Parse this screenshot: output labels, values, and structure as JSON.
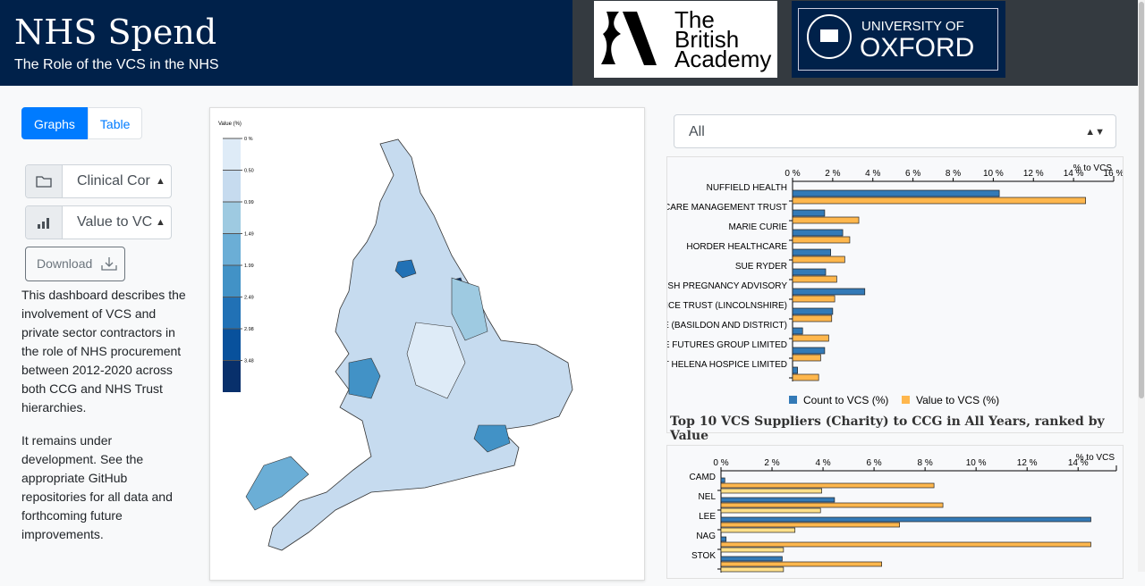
{
  "header": {
    "title": "NHS Spend",
    "subtitle": "The Role of the VCS in the NHS",
    "logo_ba": "The British Academy",
    "logo_ox_top": "UNIVERSITY OF",
    "logo_ox_bottom": "OXFORD"
  },
  "view_toggle": {
    "graphs": "Graphs",
    "table": "Table",
    "active": "Graphs"
  },
  "controls": {
    "hierarchy_select": "Clinical Cor",
    "hierarchy_icon": "folder-icon",
    "metric_select": "Value to VC",
    "metric_icon": "bar-chart-icon",
    "download": "Download",
    "download_icon": "download-icon"
  },
  "description": [
    "This dashboard describes the involvement of VCS and private sector contractors in the role of NHS procurement between 2012-2020 across both CCG and NHS Trust hierarchies.",
    "It remains under development. See the appropriate GitHub repositories for all data and forthcoming future improvements."
  ],
  "map": {
    "legend_title": "Value (%)",
    "legend_ticks": [
      "0 %",
      "0.50",
      "0.99",
      "1.49",
      "1.99",
      "2.49",
      "2.98",
      "3.48"
    ],
    "colors": [
      "#deebf7",
      "#c6dbef",
      "#9ecae1",
      "#6baed6",
      "#4292c6",
      "#2171b5",
      "#08519c",
      "#08306b"
    ]
  },
  "filter_select": "All",
  "chart_data": [
    {
      "type": "bar",
      "orientation": "horizontal",
      "title": "Top 10 VCS Suppliers (Charity) to CCG in All Years, ranked by Value",
      "xlabel": "% to VCS",
      "xlim": [
        0,
        16
      ],
      "xticks": [
        "0 %",
        "2 %",
        "4 %",
        "6 %",
        "8 %",
        "10 %",
        "12 %",
        "14 %",
        "16 %"
      ],
      "legend": "bottom",
      "categories": [
        "NUFFIELD HEALTH",
        "THE HEALTHCARE MANAGEMENT TRUST",
        "MARIE CURIE",
        "HORDER HEALTHCARE",
        "SUE RYDER",
        "BRITISH PREGNANCY ADVISORY",
        "ST BARNABAS HOSPICE TRUST (LINCOLNSHIRE)",
        "ST LUKES HOSPICE (BASILDON AND DISTRICT)",
        "ALTERNATIVE FUTURES GROUP LIMITED",
        "ST HELENA HOSPICE LIMITED"
      ],
      "series": [
        {
          "name": "Count to VCS (%)",
          "color": "#337ab7",
          "values": [
            10.3,
            1.6,
            2.5,
            1.9,
            1.65,
            3.6,
            2.0,
            0.5,
            1.6,
            0.25
          ]
        },
        {
          "name": "Value to VCS (%)",
          "color": "#ffb74d",
          "values": [
            14.6,
            3.3,
            2.85,
            2.6,
            2.2,
            2.1,
            1.95,
            1.8,
            1.4,
            1.3
          ]
        }
      ]
    },
    {
      "type": "bar",
      "orientation": "horizontal",
      "xlabel": "% to VCS",
      "xlim": [
        0,
        15.5
      ],
      "xticks": [
        "0 %",
        "2 %",
        "4 %",
        "6 %",
        "8 %",
        "10 %",
        "12 %",
        "14 %"
      ],
      "categories": [
        "CAMD",
        "NEL",
        "LEE",
        "NAG",
        "STOK"
      ],
      "series": [
        {
          "color": "#337ab7",
          "values": [
            0.15,
            4.45,
            14.5,
            0.2,
            2.4
          ]
        },
        {
          "color": "#ffb74d",
          "values": [
            8.35,
            8.7,
            7.0,
            14.5,
            6.3
          ]
        },
        {
          "color": "#ffe08a",
          "values": [
            3.95,
            3.9,
            2.9,
            2.45,
            2.45
          ]
        }
      ]
    }
  ]
}
